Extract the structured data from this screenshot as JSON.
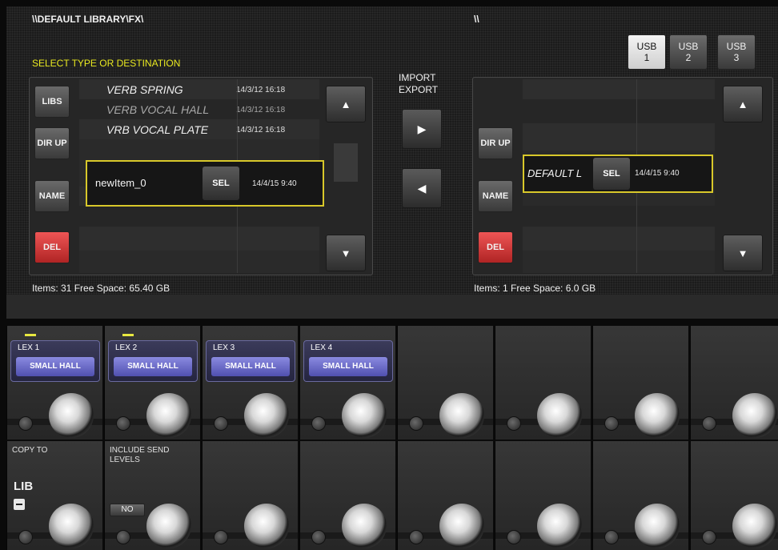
{
  "left_path": "\\\\DEFAULT LIBRARY\\FX\\",
  "right_path": "\\\\",
  "select_hint": "SELECT TYPE OR DESTINATION",
  "left_panel": {
    "buttons": {
      "libs": "LIBS",
      "dir_up": "DIR UP",
      "name": "NAME",
      "del": "DEL"
    },
    "items": [
      {
        "name": "VERB SPRING",
        "date": "14/3/12  16:18"
      },
      {
        "name": "VERB VOCAL HALL",
        "date": "14/3/12  16:18"
      },
      {
        "name": "VRB VOCAL PLATE",
        "date": "14/3/12  16:18"
      }
    ],
    "selected": {
      "name": "newItem_0",
      "sel_label": "SEL",
      "date": "14/4/15  9:40"
    },
    "status": "Items: 31 Free Space: 65.40 GB"
  },
  "transfer": {
    "import_label": "IMPORT",
    "export_label": "EXPORT",
    "right_arrow": "▶",
    "left_arrow": "◀"
  },
  "right_panel": {
    "buttons": {
      "dir_up": "DIR UP",
      "name": "NAME",
      "del": "DEL"
    },
    "selected": {
      "name": "DEFAULT L",
      "sel_label": "SEL",
      "date": "14/4/15  9:40"
    },
    "status": "Items: 1 Free Space: 6.0 GB"
  },
  "scroll": {
    "up": "▲",
    "down": "▼"
  },
  "usb": [
    {
      "line1": "USB",
      "line2": "1",
      "active": true
    },
    {
      "line1": "USB",
      "line2": "2",
      "active": false
    },
    {
      "line1": "USB",
      "line2": "3",
      "active": false
    }
  ],
  "channels": [
    {
      "name": "LEX 1",
      "preset": "SMALL HALL"
    },
    {
      "name": "LEX 2",
      "preset": "SMALL HALL"
    },
    {
      "name": "LEX 3",
      "preset": "SMALL HALL"
    },
    {
      "name": "LEX 4",
      "preset": "SMALL HALL"
    }
  ],
  "lower": {
    "copy_to": "COPY TO",
    "lib": "LIB",
    "include_send_levels": "INCLUDE SEND LEVELS",
    "no_button": "NO"
  }
}
